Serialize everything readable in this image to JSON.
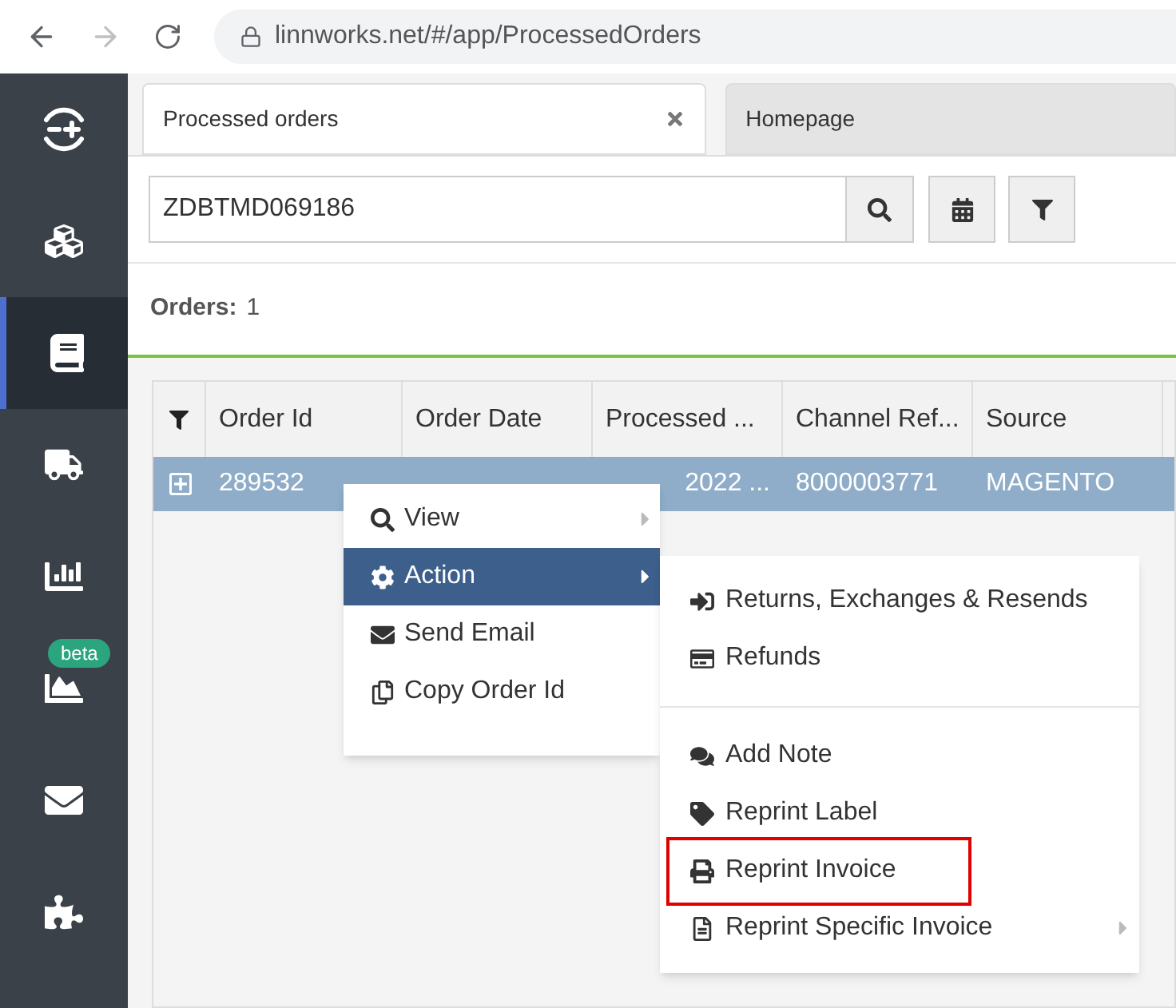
{
  "browser": {
    "url": "linnworks.net/#/app/ProcessedOrders"
  },
  "sidebar": {
    "items": [
      {
        "selected": false
      },
      {
        "selected": false
      },
      {
        "selected": true
      },
      {
        "selected": false
      },
      {
        "selected": false
      },
      {
        "selected": false,
        "badge": "beta"
      },
      {
        "selected": false
      },
      {
        "selected": false
      }
    ]
  },
  "tabs": [
    {
      "label": "Processed orders",
      "selected": true,
      "closable": true
    },
    {
      "label": "Homepage",
      "selected": false,
      "closable": false
    }
  ],
  "search": {
    "value": "ZDBTMD069186"
  },
  "orders": {
    "label": "Orders:",
    "count": "1"
  },
  "table": {
    "columns": [
      "Order Id",
      "Order Date",
      "Processed ...",
      "Channel Ref...",
      "Source"
    ],
    "rows": [
      {
        "selected": true,
        "cells": [
          "289532",
          null,
          "2022 ...",
          "8000003771",
          "MAGENTO"
        ]
      }
    ]
  },
  "context_menu": {
    "items": [
      {
        "label": "View",
        "selected": false,
        "submenu": true
      },
      {
        "label": "Action",
        "selected": true,
        "submenu": true
      },
      {
        "label": "Send Email",
        "selected": false,
        "submenu": false
      },
      {
        "label": "Copy Order Id",
        "selected": false,
        "submenu": false
      }
    ]
  },
  "action_submenu": {
    "items": [
      {
        "label": "Returns, Exchanges & Resends",
        "highlighted": false,
        "submenu": false
      },
      {
        "label": "Refunds",
        "highlighted": false,
        "submenu": false
      },
      {
        "kind": "separator"
      },
      {
        "label": "Add Note",
        "highlighted": false,
        "submenu": false
      },
      {
        "label": "Reprint Label",
        "highlighted": false,
        "submenu": false
      },
      {
        "label": "Reprint Invoice",
        "highlighted": true,
        "submenu": false
      },
      {
        "label": "Reprint Specific Invoice",
        "highlighted": false,
        "submenu": true
      }
    ]
  }
}
